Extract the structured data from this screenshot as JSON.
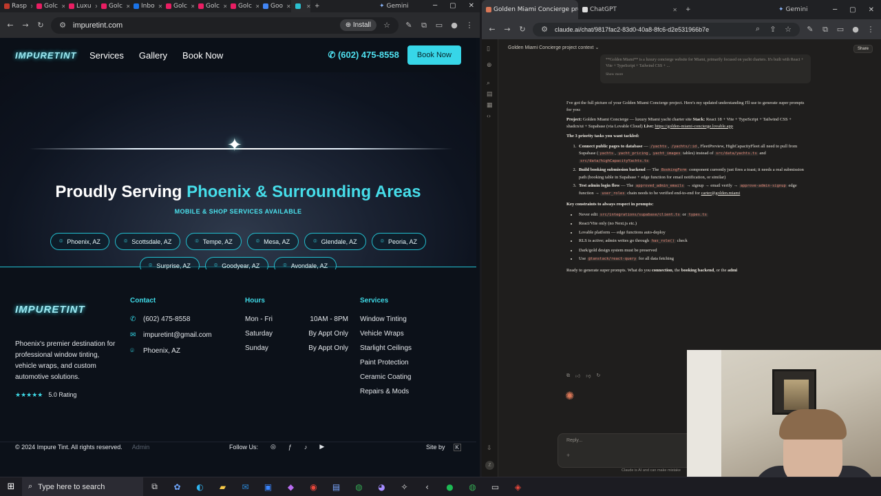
{
  "left_browser": {
    "tabs": [
      {
        "label": "Rasp",
        "color": "#c0392b"
      },
      {
        "label": "Golc",
        "color": "#e91e63"
      },
      {
        "label": "Luxu",
        "color": "#e91e63"
      },
      {
        "label": "Golc",
        "color": "#e91e63"
      },
      {
        "label": "Inbo",
        "color": "#1a73e8"
      },
      {
        "label": "Golc",
        "color": "#e91e63"
      },
      {
        "label": "Golc",
        "color": "#e91e63"
      },
      {
        "label": "Golc",
        "color": "#e91e63"
      },
      {
        "label": "Goo",
        "color": "#4285f4"
      },
      {
        "label": "",
        "color": "#2bc0d0"
      }
    ],
    "gemini_tab": "Gemini",
    "url": "impuretint.com",
    "install_label": "Install"
  },
  "site": {
    "logo_text": "IMPURETINT",
    "nav": [
      "Services",
      "Gallery",
      "Book Now"
    ],
    "phone": "(602) 475-8558",
    "book_button": "Book Now",
    "hero_title_white": "Proudly Serving ",
    "hero_title_accent": "Phoenix & Surrounding Areas",
    "hero_subtitle": "MOBILE & SHOP SERVICES AVAILABLE",
    "cities_row1": [
      "Phoenix, AZ",
      "Scottsdale, AZ",
      "Tempe, AZ",
      "Mesa, AZ",
      "Glendale, AZ",
      "Peoria, AZ"
    ],
    "cities_row2": [
      "Surprise, AZ",
      "Goodyear, AZ",
      "Avondale, AZ"
    ],
    "footer": {
      "blurb": "Phoenix's premier destination for professional window tinting, vehicle wraps, and custom automotive solutions.",
      "stars": "★★★★★",
      "rating": "5.0 Rating",
      "contact_heading": "Contact",
      "contact": [
        "(602) 475-8558",
        "impuretint@gmail.com",
        "Phoenix, AZ"
      ],
      "hours_heading": "Hours",
      "hours": [
        {
          "day": "Mon - Fri",
          "time": "10AM - 8PM"
        },
        {
          "day": "Saturday",
          "time": "By Appt Only"
        },
        {
          "day": "Sunday",
          "time": "By Appt Only"
        }
      ],
      "services_heading": "Services",
      "services": [
        "Window Tinting",
        "Vehicle Wraps",
        "Starlight Ceilings",
        "Paint Protection",
        "Ceramic Coating",
        "Repairs & Mods"
      ],
      "copyright": "© 2024 Impure Tint. All rights reserved.",
      "admin": "Admin",
      "follow": "Follow Us:",
      "site_by": "Site by",
      "site_by_mark": "K"
    }
  },
  "right_browser": {
    "tab1": "Golden Miami Concierge project",
    "tab2": "ChatGPT",
    "gemini_tab": "Gemini",
    "url": "claude.ai/chat/9817fac2-83d0-40a8-8fc6-d2e531966b7e"
  },
  "claude": {
    "chat_title": "Golden Miami Concierge project context",
    "share": "Share",
    "user_msg": "**Golden Miami** is a luxury concierge website for Miami, primarily focused on yacht charters. It's built with React + Vite + TypeScript + Tailwind CSS + ...",
    "show_more": "Show more",
    "intro": "I've got the full picture of your Golden Miami Concierge project. Here's my updated understanding I'll use to generate super prompts for you:",
    "project_label": "Project:",
    "project_text": " Golden Miami Concierge — luxury Miami yacht charter site ",
    "stack_label": "Stack:",
    "stack_text": " React 18 + Vite + TypeScript + Tailwind CSS + shadcn/ui + Supabase (via Lovable Cloud) ",
    "live_label": "Live:",
    "live_url": "https://golden-miami-concierge.lovable.app",
    "tasks_heading": "The 3 priority tasks you want tackled:",
    "task1_label": "Connect public pages to database",
    "task1_pre": " — ",
    "task1_c1": "/yachts",
    "task1_c2": "/yachts/:id",
    "task1_mid": ", FleetPreview, HighCapacityFleet all need to pull from Supabase (",
    "task1_c3": "yachts",
    "task1_c4": "yacht_pricing",
    "task1_c5": "yacht_images",
    "task1_mid2": " tables) instead of ",
    "task1_c6": "src/data/yachts.ts",
    "task1_and": " and ",
    "task1_c7": "src/data/highCapacityYachts.ts",
    "task2_label": "Build booking submission backend",
    "task2_pre": " — The ",
    "task2_c1": "BookingForm",
    "task2_text": " component currently just fires a toast; it needs a real submission path (booking table in Supabase + edge function for email notification, or similar)",
    "task3_label": "Test admin login flow",
    "task3_pre": " — The ",
    "task3_c1": "approved_admin_emails",
    "task3_mid": " → signup → email verify → ",
    "task3_c2": "approve-admin-signup",
    "task3_mid2": " edge function → ",
    "task3_c3": "user_roles",
    "task3_text": " chain needs to be verified end-to-end for ",
    "task3_link": "carter@golden.miami",
    "constraints_heading": "Key constraints to always respect in prompts:",
    "c1_pre": "Never edit ",
    "c1_code1": "src/integrations/supabase/client.ts",
    "c1_or": " or ",
    "c1_code2": "types.ts",
    "c2": "React/Vite only (no Next.js etc.)",
    "c3": "Lovable platform — edge functions auto-deploy",
    "c4_pre": "RLS is active; admin writes go through ",
    "c4_code": "has_role()",
    "c4_post": " check",
    "c5": "Dark/gold design system must be preserved",
    "c6_pre": "Use ",
    "c6_code": "@tanstack/react-query",
    "c6_post": " for all data fetching",
    "closing_pre": "Ready to generate super prompts. What do you ",
    "closing_b1": "connection",
    "closing_mid": ", the ",
    "closing_b2": "booking backend",
    "closing_mid2": ", or the ",
    "closing_b3": "admi",
    "reply_placeholder": "Reply...",
    "disclaimer": "Claude is AI and can make mistake"
  },
  "taskbar": {
    "search_placeholder": "Type here to search"
  }
}
